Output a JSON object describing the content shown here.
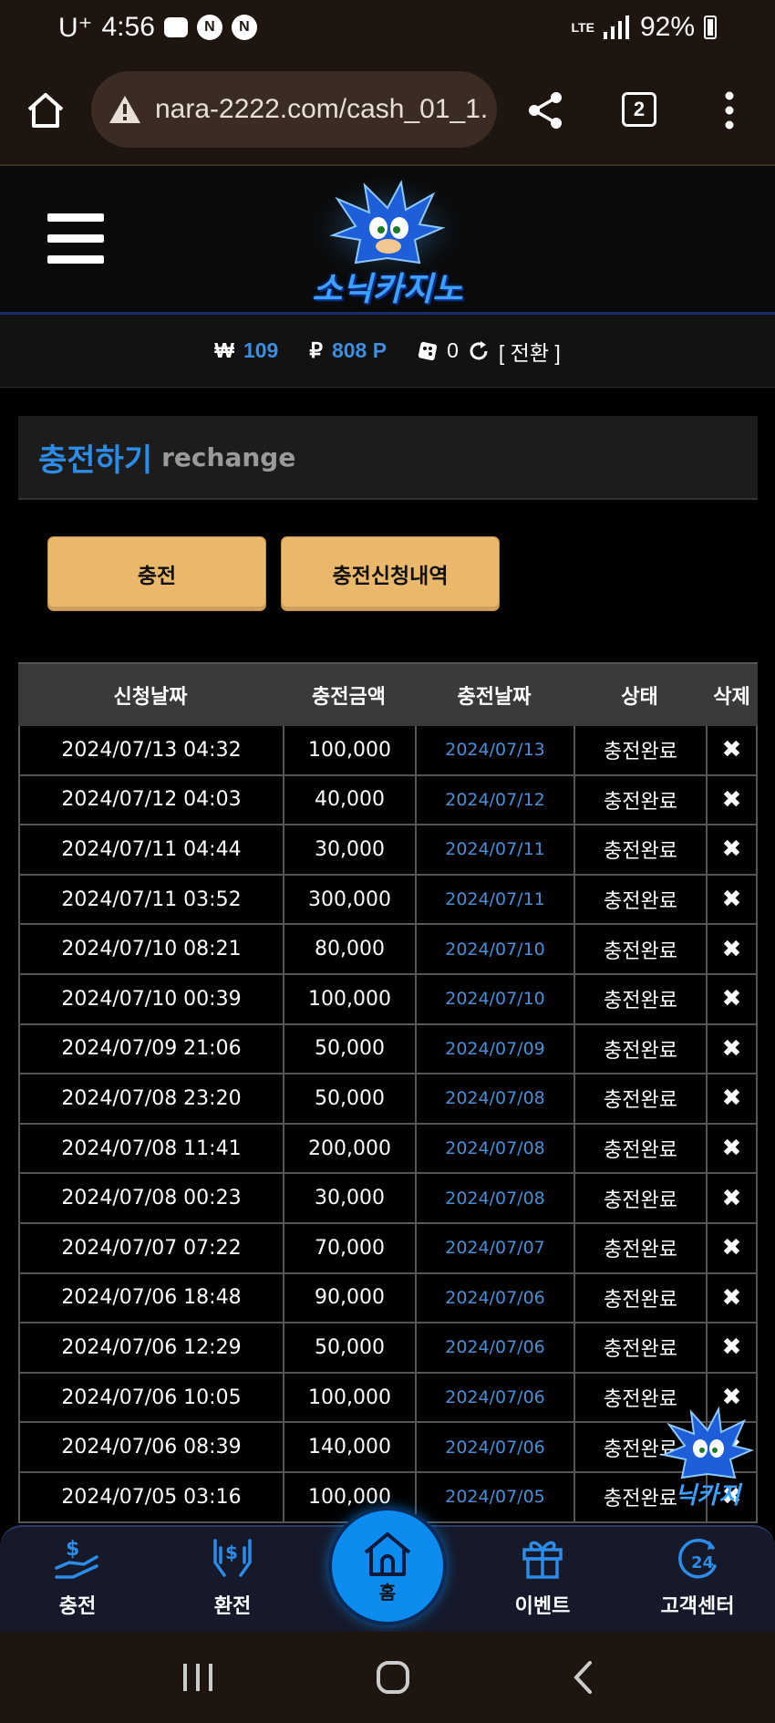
{
  "status_bar": {
    "carrier": "U⁺",
    "time": "4:56",
    "notif_icons": [
      "N",
      "N"
    ],
    "network": "LTE",
    "battery": "92%"
  },
  "browser": {
    "url": "nara-2222.com/cash_01_1.",
    "tab_count": "2"
  },
  "site": {
    "logo_text": "소닉카지노"
  },
  "wallet": {
    "won_symbol": "₩",
    "won_value": "109",
    "point_symbol": "₽",
    "point_value": "808 P",
    "chip_value": "0",
    "convert_label": "[ 전환 ]"
  },
  "panel": {
    "title_ko": "충전하기",
    "title_en": "rechange"
  },
  "buttons": {
    "charge": "충전",
    "history": "충전신청내역"
  },
  "table": {
    "headers": [
      "신청날짜",
      "충전금액",
      "충전날짜",
      "상태",
      "삭제"
    ],
    "delete_symbol": "✖",
    "rows": [
      {
        "requested": "2024/07/13 04:32",
        "amount": "100,000",
        "charged": "2024/07/13",
        "status": "충전완료"
      },
      {
        "requested": "2024/07/12 04:03",
        "amount": "40,000",
        "charged": "2024/07/12",
        "status": "충전완료"
      },
      {
        "requested": "2024/07/11 04:44",
        "amount": "30,000",
        "charged": "2024/07/11",
        "status": "충전완료"
      },
      {
        "requested": "2024/07/11 03:52",
        "amount": "300,000",
        "charged": "2024/07/11",
        "status": "충전완료"
      },
      {
        "requested": "2024/07/10 08:21",
        "amount": "80,000",
        "charged": "2024/07/10",
        "status": "충전완료"
      },
      {
        "requested": "2024/07/10 00:39",
        "amount": "100,000",
        "charged": "2024/07/10",
        "status": "충전완료"
      },
      {
        "requested": "2024/07/09 21:06",
        "amount": "50,000",
        "charged": "2024/07/09",
        "status": "충전완료"
      },
      {
        "requested": "2024/07/08 23:20",
        "amount": "50,000",
        "charged": "2024/07/08",
        "status": "충전완료"
      },
      {
        "requested": "2024/07/08 11:41",
        "amount": "200,000",
        "charged": "2024/07/08",
        "status": "충전완료"
      },
      {
        "requested": "2024/07/08 00:23",
        "amount": "30,000",
        "charged": "2024/07/08",
        "status": "충전완료"
      },
      {
        "requested": "2024/07/07 07:22",
        "amount": "70,000",
        "charged": "2024/07/07",
        "status": "충전완료"
      },
      {
        "requested": "2024/07/06 18:48",
        "amount": "90,000",
        "charged": "2024/07/06",
        "status": "충전완료"
      },
      {
        "requested": "2024/07/06 12:29",
        "amount": "50,000",
        "charged": "2024/07/06",
        "status": "충전완료"
      },
      {
        "requested": "2024/07/06 10:05",
        "amount": "100,000",
        "charged": "2024/07/06",
        "status": "충전완료"
      },
      {
        "requested": "2024/07/06 08:39",
        "amount": "140,000",
        "charged": "2024/07/06",
        "status": "충전완료"
      },
      {
        "requested": "2024/07/05 03:16",
        "amount": "100,000",
        "charged": "2024/07/05",
        "status": "충전완료"
      }
    ]
  },
  "bottom_nav": {
    "charge": "충전",
    "exchange": "환전",
    "home": "홈",
    "event": "이벤트",
    "support": "고객센터"
  },
  "colors": {
    "accent_blue": "#2c8ce8",
    "button_gold": "#e9b86a",
    "home_blue": "#0d8cf0"
  }
}
